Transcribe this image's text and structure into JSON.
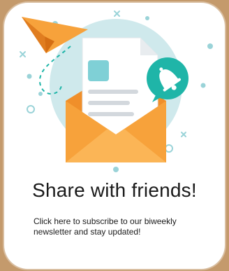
{
  "card": {
    "title": "Share with friends!",
    "subtitle": "Click here to subscribe to our biweekly newsletter and stay updated!"
  },
  "icons": {
    "illustration": "newsletter-envelope-illustration",
    "plane": "paper-plane-icon",
    "bell": "notification-bell-icon"
  },
  "colors": {
    "background": "#c49a6c",
    "card": "#ffffff",
    "teal": "#1fb5a8",
    "orange": "#f7a23b",
    "circle": "#cfe9ec"
  }
}
